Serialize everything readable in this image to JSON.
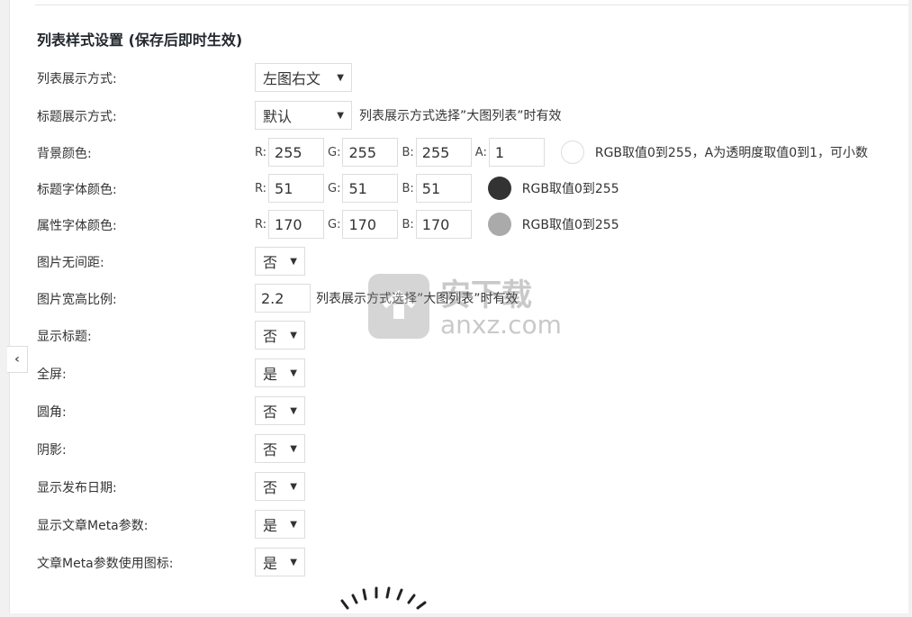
{
  "section_title": "列表样式设置 (保存后即时生效)",
  "rows": [
    {
      "label": "列表展示方式:",
      "value": "左图右文",
      "hint": ""
    },
    {
      "label": "标题展示方式:",
      "value": "默认",
      "hint": "列表展示方式选择”大图列表”时有效"
    },
    {
      "label": "背景颜色:",
      "r": "255",
      "g": "255",
      "b": "255",
      "a": "1",
      "hint": "RGB取值0到255，A为透明度取值0到1，可小数",
      "color": "#ffffff"
    },
    {
      "label": "标题字体颜色:",
      "r": "51",
      "g": "51",
      "b": "51",
      "hint": "RGB取值0到255",
      "color": "#333333"
    },
    {
      "label": "属性字体颜色:",
      "r": "170",
      "g": "170",
      "b": "170",
      "hint": "RGB取值0到255",
      "color": "#aaaaaa"
    },
    {
      "label": "图片无间距:",
      "value": "否"
    },
    {
      "label": "图片宽高比例:",
      "value": "2.2",
      "hint": "列表展示方式选择”大图列表”时有效"
    },
    {
      "label": "显示标题:",
      "value": "否"
    },
    {
      "label": "全屏:",
      "value": "是"
    },
    {
      "label": "圆角:",
      "value": "否"
    },
    {
      "label": "阴影:",
      "value": "否"
    },
    {
      "label": "显示发布日期:",
      "value": "否"
    },
    {
      "label": "显示文章Meta参数:",
      "value": "是"
    },
    {
      "label": "文章Meta参数使用图标:",
      "value": "是"
    }
  ],
  "rgb_labels": {
    "r": "R:",
    "g": "G:",
    "b": "B:",
    "a": "A:"
  },
  "watermark": {
    "text": "anxz.com",
    "cn": "安下载"
  },
  "icons": {
    "collapse": "chevron-left-icon",
    "caret": "caret-down-icon"
  }
}
